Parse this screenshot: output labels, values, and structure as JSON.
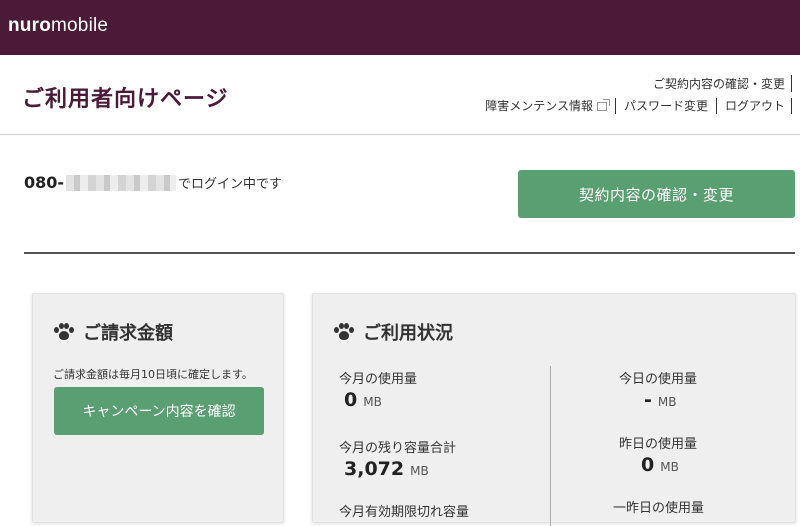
{
  "brand": {
    "logo_bold": "nuro",
    "logo_rest": "mobile"
  },
  "header": {
    "title": "ご利用者向けページ",
    "link_contract": "ご契約内容の確認・変更",
    "link_outage": "障害メンテンス情報",
    "link_password": "パスワード変更",
    "link_logout": "ログアウト"
  },
  "login": {
    "phone_prefix": "080-",
    "suffix": "でログイン中です"
  },
  "buttons": {
    "contract": "契約内容の確認・変更",
    "campaign": "キャンペーン内容を確認"
  },
  "billing": {
    "title": "ご請求金額",
    "note": "ご請求金額は毎月10日頃に確定します。"
  },
  "usage": {
    "title": "ご利用状況",
    "month_label": "今月の使用量",
    "month_value": "0",
    "month_unit": "MB",
    "remaining_label": "今月の残り容量合計",
    "remaining_value": "3,072",
    "remaining_unit": "MB",
    "cut_label": "今月有効期限切れ容量",
    "today_label": "今日の使用量",
    "today_value": "-",
    "today_unit": "MB",
    "yesterday_label": "昨日の使用量",
    "yesterday_value": "0",
    "yesterday_unit": "MB",
    "daybefore_label": "一昨日の使用量"
  },
  "icons": {
    "section": "paw-icon",
    "external": "external-link-icon"
  },
  "colors": {
    "topbar": "#4a1a38",
    "title": "#4a1a38",
    "button": "#5a9f72",
    "card_bg": "#efefef"
  }
}
